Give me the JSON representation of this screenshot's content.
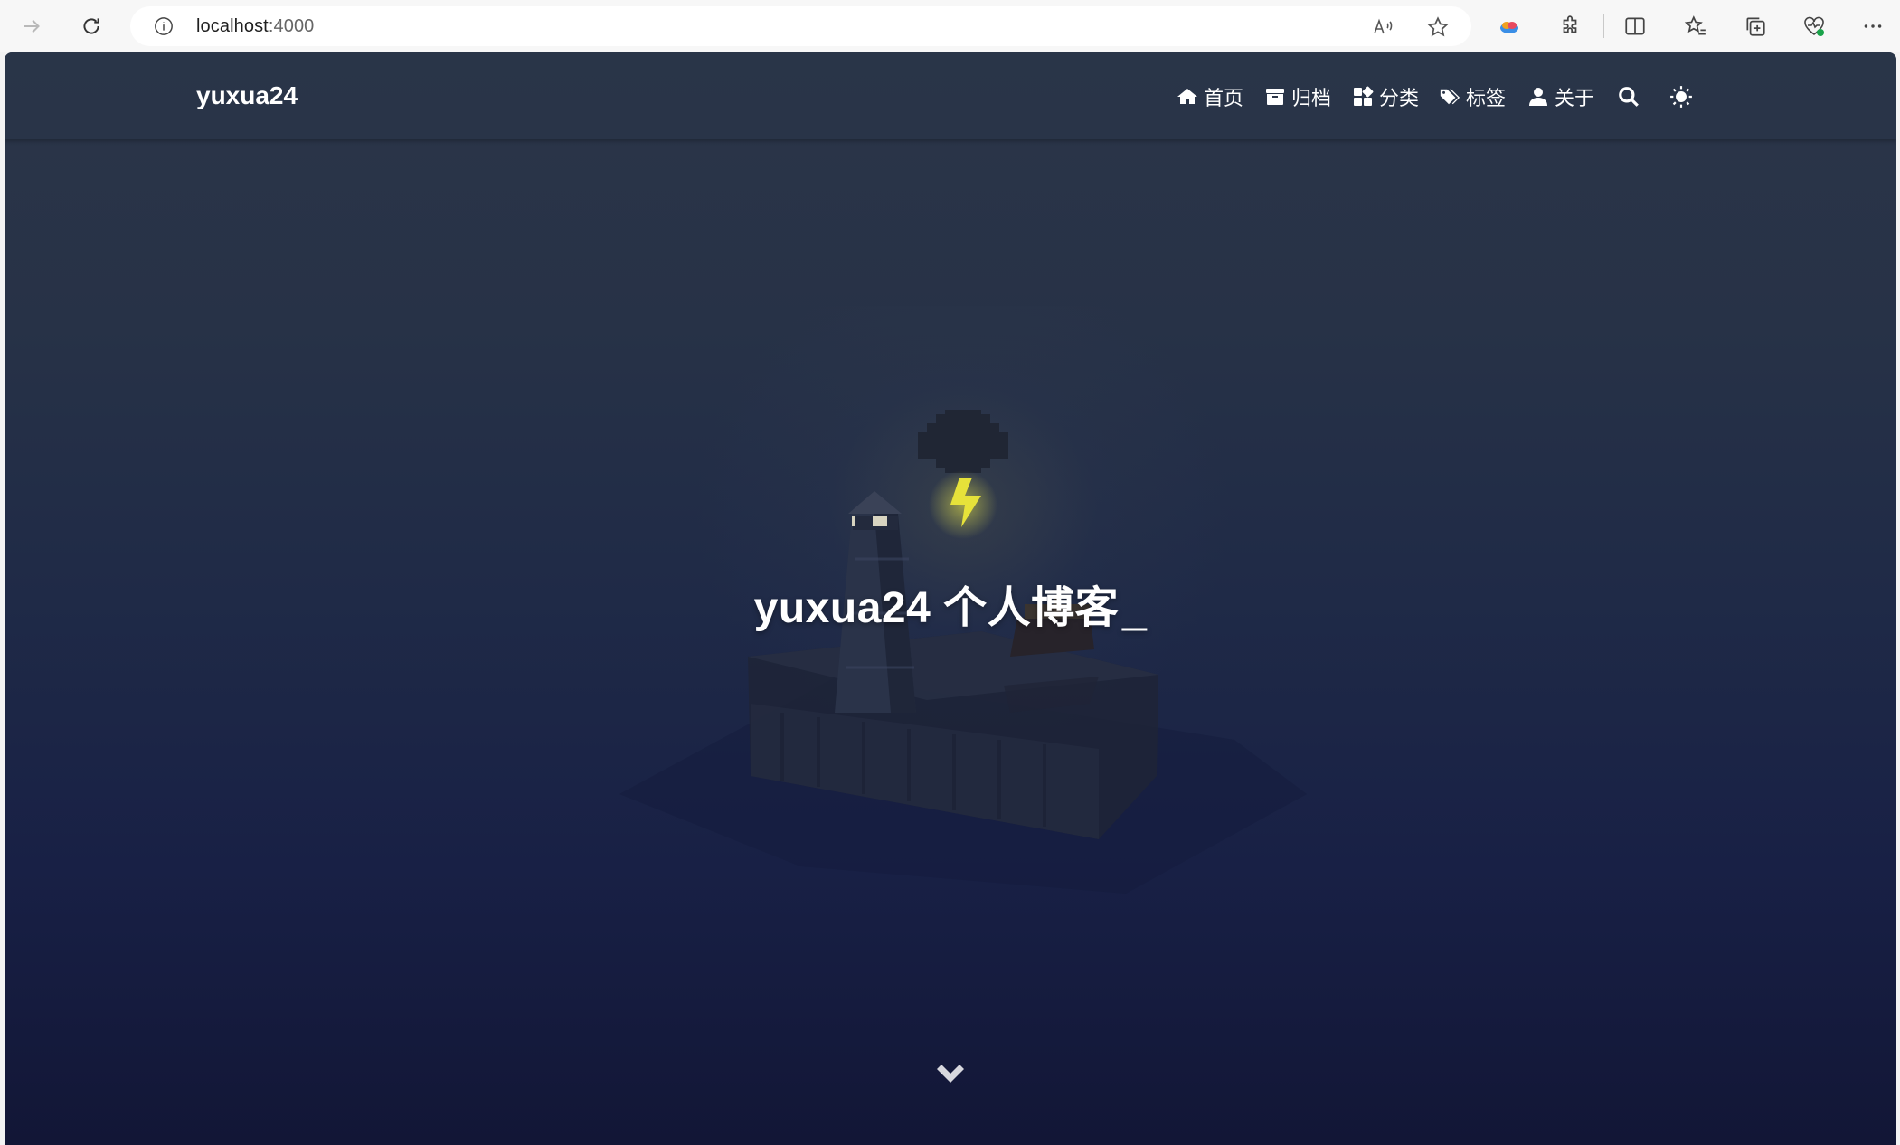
{
  "browser": {
    "url_host": "localhost",
    "url_port": ":4000",
    "read_aloud_label": "A"
  },
  "site": {
    "brand": "yuxua24",
    "nav": [
      {
        "label": "首页",
        "icon": "home-icon"
      },
      {
        "label": "归档",
        "icon": "archive-icon"
      },
      {
        "label": "分类",
        "icon": "category-icon"
      },
      {
        "label": "标签",
        "icon": "tags-icon"
      },
      {
        "label": "关于",
        "icon": "user-icon"
      }
    ],
    "search_icon": "search-icon",
    "theme_icon": "sun-icon"
  },
  "hero": {
    "title": "yuxua24 个人博客",
    "cursor": "_",
    "scroll_icon": "chevron-down-icon"
  },
  "colors": {
    "nav_text": "#ffffff",
    "bg_top": "#2b3548",
    "bg_bottom": "#121636",
    "lightning": "#e6e23a"
  }
}
